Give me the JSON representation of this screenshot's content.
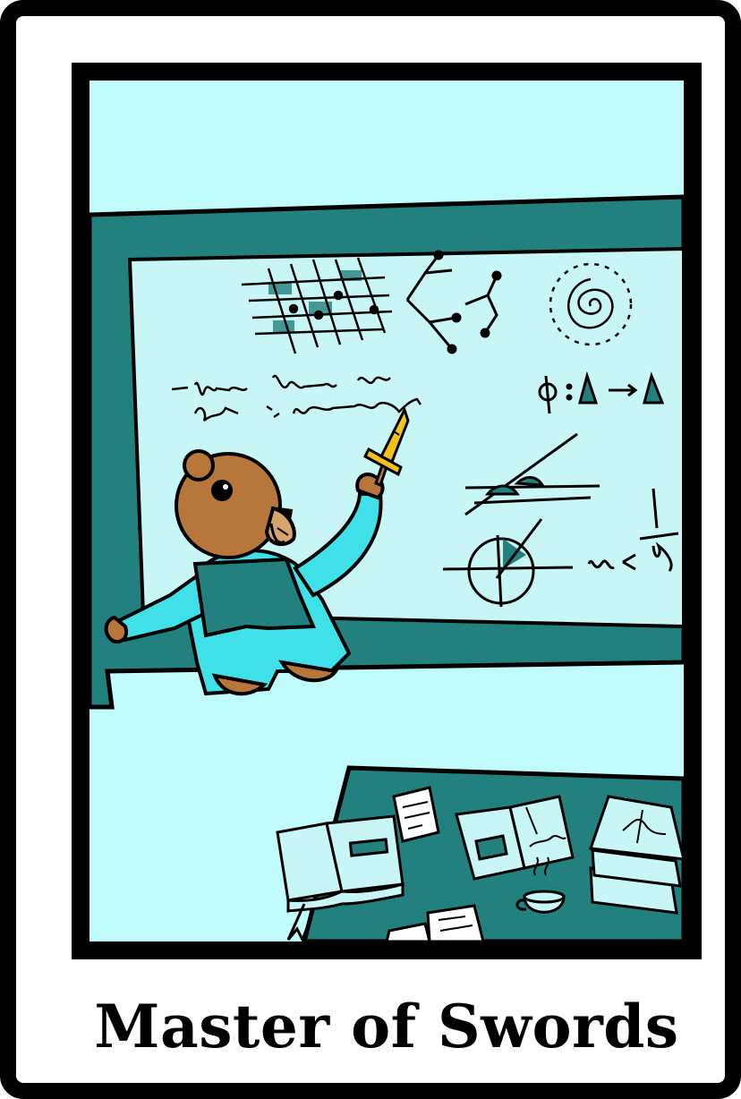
{
  "card": {
    "title": "Master of Swords",
    "colors": {
      "background": "#c2fbfb",
      "board_frame": "#22807f",
      "board_surface": "#c8f6f6",
      "bear_fur": "#b8773a",
      "robe": "#3fe0e8",
      "scarf": "#22807f",
      "sword_blade": "#f2c21a",
      "ink": "#000000"
    },
    "illustration": {
      "subject": "bear-in-robe-writing-on-whiteboard-with-sword",
      "icons": [
        "grid-diagram-icon",
        "graph-network-icon",
        "spiral-icon",
        "phi-equation-icon",
        "tangent-lines-icon",
        "circle-crosshair-icon",
        "fraction-icon",
        "book-icon",
        "papers-icon",
        "coffee-cup-icon",
        "stacked-books-icon"
      ]
    }
  }
}
